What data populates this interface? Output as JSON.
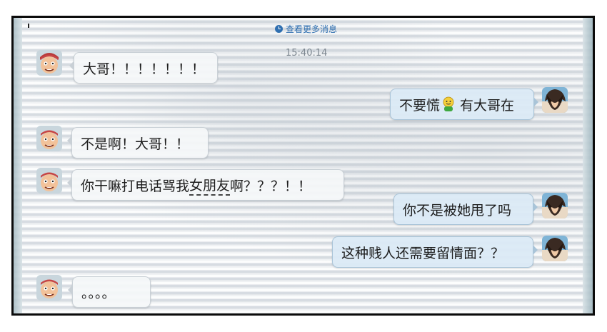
{
  "header": {
    "more_messages": "查看更多消息",
    "timestamp": "15:40:14"
  },
  "messages": [
    {
      "side": "left",
      "sender": "大哥头像",
      "text": "大哥！！！！！！！"
    },
    {
      "side": "right",
      "sender": "我的头像",
      "text_before": "不要慌",
      "emoji": "green-smiley-icon",
      "text_after": " 有大哥在"
    },
    {
      "side": "left",
      "sender": "大哥头像",
      "text": "不是啊！大哥！！"
    },
    {
      "side": "left",
      "sender": "大哥头像",
      "text_part1": "你干嘛打电话骂我",
      "text_underlined": "女朋友",
      "text_part2": "啊？？？！！"
    },
    {
      "side": "right",
      "sender": "我的头像",
      "text": "你不是被她甩了吗"
    },
    {
      "side": "right",
      "sender": "我的头像",
      "text": "这种贱人还需要留情面？？"
    },
    {
      "side": "left",
      "sender": "大哥头像",
      "text": "。。。。"
    }
  ],
  "colors": {
    "link": "#2f6fb0",
    "bubble_left": "#f5f7f9",
    "bubble_right": "#dbeaf6",
    "frame": "#0b0b0b"
  }
}
